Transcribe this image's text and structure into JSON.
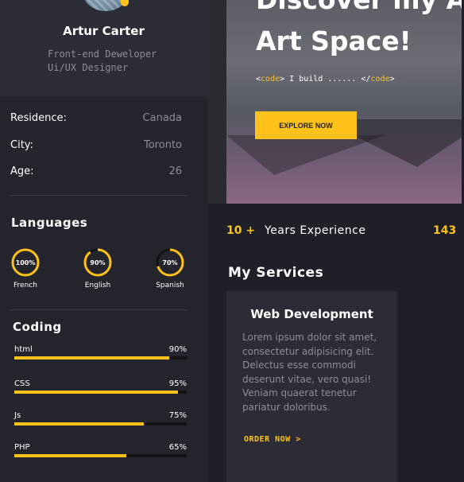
{
  "profile": {
    "name": "Artur Carter",
    "role_line1": "Front-end Deweloper",
    "role_line2": "Ui/UX Designer"
  },
  "info": [
    {
      "label": "Residence:",
      "value": "Canada"
    },
    {
      "label": "City:",
      "value": "Toronto"
    },
    {
      "label": "Age:",
      "value": "26"
    }
  ],
  "languages": {
    "title": "Languages",
    "items": [
      {
        "name": "French",
        "percent_label": "100%",
        "percent": 100
      },
      {
        "name": "English",
        "percent_label": "90%",
        "percent": 90
      },
      {
        "name": "Spanish",
        "percent_label": "70%",
        "percent": 70
      }
    ]
  },
  "coding": {
    "title": "Coding",
    "items": [
      {
        "name": "html",
        "percent_label": "90%",
        "percent": 90
      },
      {
        "name": "CSS",
        "percent_label": "95%",
        "percent": 95
      },
      {
        "name": "Js",
        "percent_label": "75%",
        "percent": 75
      },
      {
        "name": "PHP",
        "percent_label": "65%",
        "percent": 65
      }
    ]
  },
  "hero": {
    "title_top": "Discover my A",
    "title": "Art Space!",
    "code_open": "<",
    "code_tag": "code",
    "code_mid": "> I build ...... </",
    "code_tag2": "code",
    "code_close": ">",
    "button": "EXPLORE NOW"
  },
  "stats": {
    "years_num": "10 +",
    "years_label": "Years Experience",
    "second_num": "143"
  },
  "services": {
    "title": "My Services",
    "card": {
      "title": "Web Development",
      "text": "Lorem ipsum dolor sit amet, consectetur adipisicing elit. Delectus esse commodi deserunt vitae, vero quasi! Veniam quaerat tenetur pariatur doloribus.",
      "link": "ORDER NOW >"
    }
  },
  "colors": {
    "accent": "#fec21a",
    "background": "#1f1f27",
    "sidebar": "#24242d",
    "card": "#2c2c36",
    "muted_text": "#8d8d99"
  }
}
